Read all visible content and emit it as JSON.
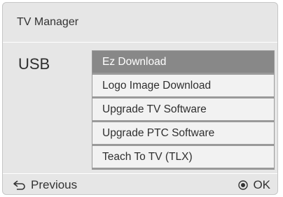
{
  "title": "TV Manager",
  "section_label": "USB",
  "menu": {
    "items": [
      {
        "label": "Ez Download",
        "selected": true
      },
      {
        "label": "Logo Image Download",
        "selected": false
      },
      {
        "label": "Upgrade TV Software",
        "selected": false
      },
      {
        "label": "Upgrade PTC Software",
        "selected": false
      },
      {
        "label": "Teach To TV (TLX)",
        "selected": false
      }
    ]
  },
  "footer": {
    "previous_label": "Previous",
    "ok_label": "OK",
    "previous_icon": "return-arrow-icon",
    "ok_icon": "ok-circle-icon"
  },
  "colors": {
    "panel_background": "#e6e6e6",
    "selected_item": "#888888",
    "item_background": "#f2f2f2"
  }
}
